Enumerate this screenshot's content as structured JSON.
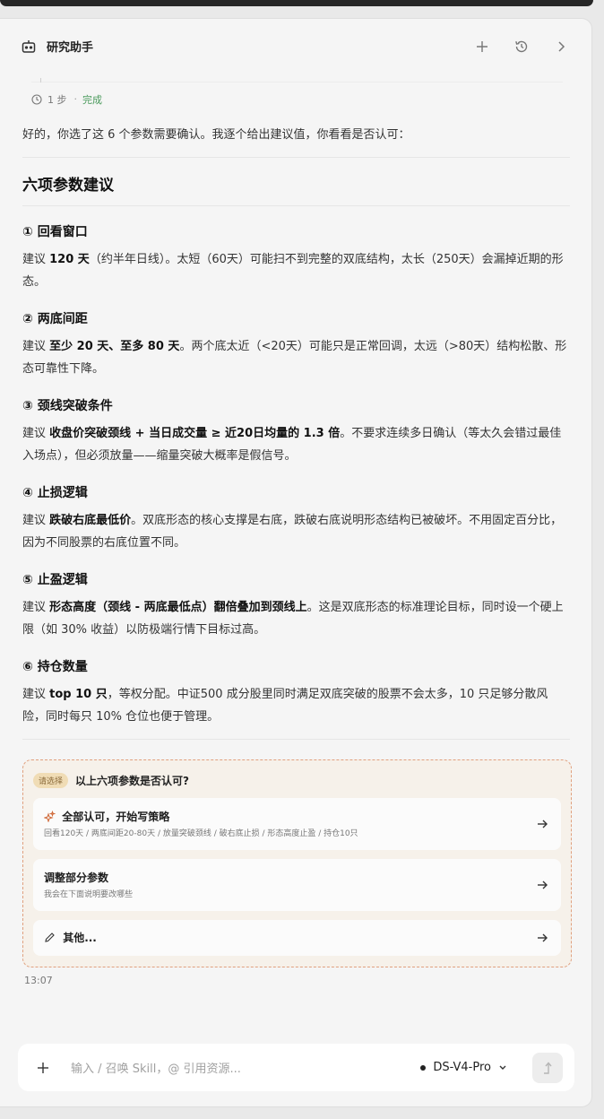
{
  "header": {
    "title": "研究助手",
    "icons": [
      "robot-icon",
      "plus-icon",
      "history-icon",
      "chevron-right-icon"
    ]
  },
  "step": {
    "count_label": "1 步",
    "separator": "·",
    "status": "完成"
  },
  "message": {
    "intro": "好的，你选了这 6 个参数需要确认。我逐个给出建议值，你看看是否认可：",
    "heading": "六项参数建议",
    "items": [
      {
        "title": "① 回看窗口",
        "prefix": "建议 ",
        "bold": "120 天",
        "rest": "（约半年日线）。太短（60天）可能扫不到完整的双底结构，太长（250天）会漏掉近期的形态。"
      },
      {
        "title": "② 两底间距",
        "prefix": "建议 ",
        "bold": "至少 20 天、至多 80 天",
        "rest": "。两个底太近（<20天）可能只是正常回调，太远（>80天）结构松散、形态可靠性下降。"
      },
      {
        "title": "③ 颈线突破条件",
        "prefix": "建议 ",
        "bold": "收盘价突破颈线 + 当日成交量 ≥ 近20日均量的 1.3 倍",
        "rest": "。不要求连续多日确认（等太久会错过最佳入场点），但必须放量——缩量突破大概率是假信号。"
      },
      {
        "title": "④ 止损逻辑",
        "prefix": "建议 ",
        "bold": "跌破右底最低价",
        "rest": "。双底形态的核心支撑是右底，跌破右底说明形态结构已被破坏。不用固定百分比，因为不同股票的右底位置不同。"
      },
      {
        "title": "⑤ 止盈逻辑",
        "prefix": "建议 ",
        "bold": "形态高度（颈线 - 两底最低点）翻倍叠加到颈线上",
        "rest": "。这是双底形态的标准理论目标，同时设一个硬上限（如 30% 收益）以防极端行情下目标过高。"
      },
      {
        "title": "⑥ 持仓数量",
        "prefix": "建议 ",
        "bold": "top 10 只",
        "rest": "，等权分配。中证500 成分股里同时满足双底突破的股票不会太多，10 只足够分散风险，同时每只 10% 仓位也便于管理。"
      }
    ]
  },
  "choice": {
    "badge": "请选择",
    "question": "以上六项参数是否认可?",
    "options": [
      {
        "title": "全部认可，开始写策略",
        "subtitle": "回看120天 / 两底间距20-80天 / 放量突破颈线 / 破右底止损 / 形态高度止盈 / 持仓10只",
        "icon": "sparkle-icon"
      },
      {
        "title": "调整部分参数",
        "subtitle": "我会在下面说明要改哪些",
        "icon": ""
      },
      {
        "title": "其他...",
        "subtitle": "",
        "icon": "pencil-icon"
      }
    ]
  },
  "timestamp": "13:07",
  "composer": {
    "placeholder": "输入 / 召唤 Skill，@ 引用资源...",
    "model": "DS-V4-Pro"
  }
}
